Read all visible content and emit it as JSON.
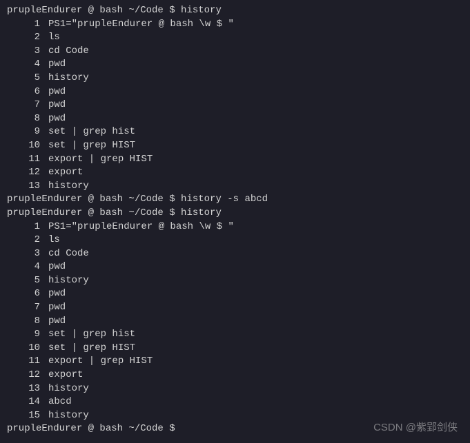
{
  "prompt_base": "prupleEndurer @ bash ~/Code $ ",
  "commands": {
    "cmd1": "history",
    "cmd2": "history -s abcd",
    "cmd3": "history",
    "cmd4": ""
  },
  "history1": [
    {
      "n": "1",
      "cmd": "PS1=\"prupleEndurer @ bash \\w $ \""
    },
    {
      "n": "2",
      "cmd": "ls"
    },
    {
      "n": "3",
      "cmd": "cd Code"
    },
    {
      "n": "4",
      "cmd": "pwd"
    },
    {
      "n": "5",
      "cmd": "history"
    },
    {
      "n": "6",
      "cmd": "pwd"
    },
    {
      "n": "7",
      "cmd": "pwd"
    },
    {
      "n": "8",
      "cmd": "pwd"
    },
    {
      "n": "9",
      "cmd": "set | grep hist"
    },
    {
      "n": "10",
      "cmd": "set | grep HIST"
    },
    {
      "n": "11",
      "cmd": "export | grep HIST"
    },
    {
      "n": "12",
      "cmd": "export"
    },
    {
      "n": "13",
      "cmd": "history"
    }
  ],
  "history2": [
    {
      "n": "1",
      "cmd": "PS1=\"prupleEndurer @ bash \\w $ \""
    },
    {
      "n": "2",
      "cmd": "ls"
    },
    {
      "n": "3",
      "cmd": "cd Code"
    },
    {
      "n": "4",
      "cmd": "pwd"
    },
    {
      "n": "5",
      "cmd": "history"
    },
    {
      "n": "6",
      "cmd": "pwd"
    },
    {
      "n": "7",
      "cmd": "pwd"
    },
    {
      "n": "8",
      "cmd": "pwd"
    },
    {
      "n": "9",
      "cmd": "set | grep hist"
    },
    {
      "n": "10",
      "cmd": "set | grep HIST"
    },
    {
      "n": "11",
      "cmd": "export | grep HIST"
    },
    {
      "n": "12",
      "cmd": "export"
    },
    {
      "n": "13",
      "cmd": "history"
    },
    {
      "n": "14",
      "cmd": "abcd"
    },
    {
      "n": "15",
      "cmd": "history"
    }
  ],
  "watermark": "CSDN @紫郢剑侠"
}
